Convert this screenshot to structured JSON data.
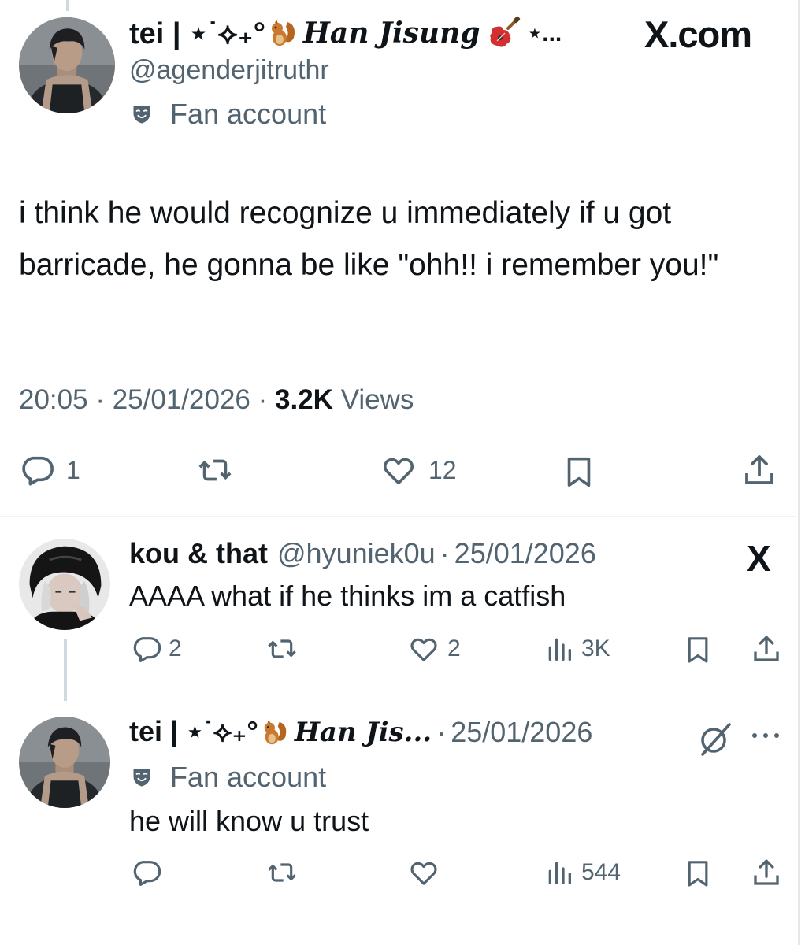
{
  "main_tweet": {
    "display_name_prefix": "tei | ⋆˙⟡₊°",
    "display_name_script": "Han Jisung",
    "display_name_suffix": "⋆...",
    "handle": "@agenderjitruthr",
    "label": "Fan account",
    "source_watermark": "X.com",
    "text": "i think he would recognize u immediately if u got barricade, he gonna be like \"ohh!! i remember you!\"",
    "time": "20:05",
    "date": "25/01/2026",
    "views_count": "3.2K",
    "views_label": "Views",
    "separator": "·",
    "replies": "1",
    "likes": "12"
  },
  "replies": [
    {
      "display_name": "kou & that",
      "handle": "@hyuniek0u",
      "separator": "·",
      "date": "25/01/2026",
      "text": "AAAA what if he thinks im a catfish",
      "replies": "2",
      "likes": "2",
      "views": "3K"
    },
    {
      "display_name_prefix": "tei | ⋆˙⟡₊°",
      "display_name_script": "Han Jis...",
      "separator": "·",
      "date": "25/01/2026",
      "label": "Fan account",
      "text": "he will know u trust",
      "views": "544"
    }
  ],
  "icons": [
    "reply-icon",
    "retweet-icon",
    "like-icon",
    "bookmark-icon",
    "share-icon",
    "views-icon",
    "grok-icon",
    "more-icon",
    "fan-account-icon",
    "x-logo-icon",
    "squirrel-emoji",
    "guitar-emoji"
  ],
  "colors": {
    "text": "#0f1419",
    "secondary": "#536471",
    "divider": "#eff3f4",
    "thread": "#cfd9de"
  }
}
